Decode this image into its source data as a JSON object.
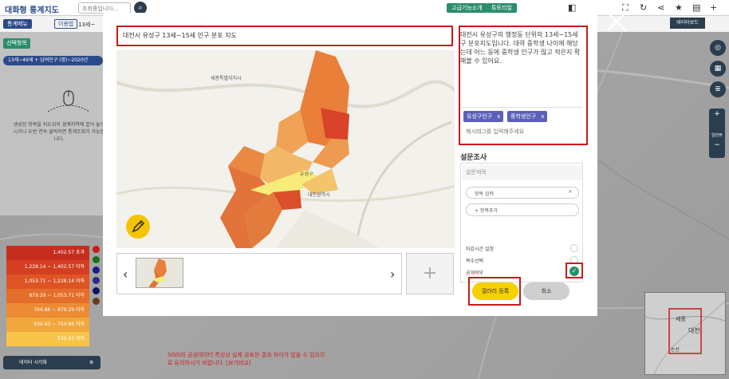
{
  "app": {
    "title": "대화형 통계지도",
    "search_placeholder": "조회중입니다...",
    "top_buttons": [
      "고급기능소개",
      "튜토리얼"
    ],
    "menu_label": "통계메뉴",
    "usage_label": "이용법",
    "region_path": "13세~",
    "select_area": "선택항목",
    "year_chip": "13세~49세 + 남여인구 (명)~2020년",
    "left_note": "생성된 항목을 지도위의 경계지역에 끌어 놓으시거나 두번 연속 클릭하면 통계조회가 가능합니다.",
    "dashboard": "데이터보드",
    "bottom_warning": "SGIS의 공공데이터 특성상 실제 공표된 결과 차이가 있을 수 있으므로 유의하시기 바랍니다. [보기비교]",
    "dataviz_label": "데이터 시각화",
    "legend": [
      {
        "label": "1,402.57 초과",
        "color": "#c62d1f"
      },
      {
        "label": "1,228.14 ~ 1,402.57 이하",
        "color": "#d43e21"
      },
      {
        "label": "1,053.71 ~ 1,228.14 이하",
        "color": "#de5424"
      },
      {
        "label": "879.29 ~ 1,053.71 이하",
        "color": "#e56e2a"
      },
      {
        "label": "704.86 ~ 879.29 이하",
        "color": "#ec8b33"
      },
      {
        "label": "530.43 ~ 704.86 이하",
        "color": "#f2a73c"
      },
      {
        "label": "530.43 이하",
        "color": "#f7c44a"
      }
    ],
    "legend_dot_colors": [
      "#c91a1a",
      "#1a6e1a",
      "#1a1a8a",
      "#2a2a8a",
      "#101060",
      "#6a3a1a"
    ],
    "right_rail": [
      "지도",
      "통계",
      "범례"
    ],
    "zoom": {
      "plus": "+",
      "label": "일반뷰",
      "minus": "−"
    },
    "minimap_labels": [
      "세종",
      "대전",
      "논산"
    ]
  },
  "modal": {
    "title_value": "대전시 유성구 13세~15세 인구 분포 지도",
    "description": "대전시 유성구의 행정동 단위의 13세~15세 구 분포지도입니다. 대략 중학생 나이에 해당 는데 어느 동에 중학생 인구가 많고 적은지 확 해볼 수 있어요.",
    "tags": [
      "유성구인구",
      "중학생인구"
    ],
    "tag_remove": "x",
    "tag_placeholder": "해시태그를 입력해주세요",
    "add_image": "+",
    "survey": {
      "title": "설문조사",
      "name_placeholder": "설문제목",
      "item_placeholder": "항목 입력",
      "item_remove": "×",
      "add_item": "+ 항목추가",
      "options": [
        {
          "label": "마감시간 설정",
          "checked": false
        },
        {
          "label": "복수선택",
          "checked": false
        },
        {
          "label": "공개여부",
          "checked": true
        }
      ]
    },
    "submit_label": "갤러리 등록",
    "cancel_label": "취소",
    "map_labels": [
      "세종특별자치시",
      "대전광역시",
      "유성구"
    ]
  }
}
